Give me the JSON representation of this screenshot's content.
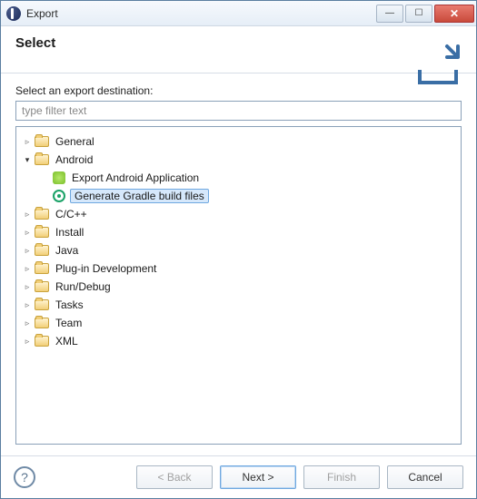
{
  "window": {
    "title": "Export"
  },
  "header": {
    "title": "Select"
  },
  "body": {
    "prompt": "Select an export destination:",
    "filter_placeholder": "type filter text"
  },
  "tree": [
    {
      "label": "General",
      "expanded": false
    },
    {
      "label": "Android",
      "expanded": true,
      "children": [
        {
          "label": "Export Android Application",
          "icon": "android",
          "selected": false
        },
        {
          "label": "Generate Gradle build files",
          "icon": "gradle",
          "selected": true
        }
      ]
    },
    {
      "label": "C/C++",
      "expanded": false
    },
    {
      "label": "Install",
      "expanded": false
    },
    {
      "label": "Java",
      "expanded": false
    },
    {
      "label": "Plug-in Development",
      "expanded": false
    },
    {
      "label": "Run/Debug",
      "expanded": false
    },
    {
      "label": "Tasks",
      "expanded": false
    },
    {
      "label": "Team",
      "expanded": false
    },
    {
      "label": "XML",
      "expanded": false
    }
  ],
  "footer": {
    "back": "< Back",
    "next": "Next >",
    "finish": "Finish",
    "cancel": "Cancel"
  }
}
